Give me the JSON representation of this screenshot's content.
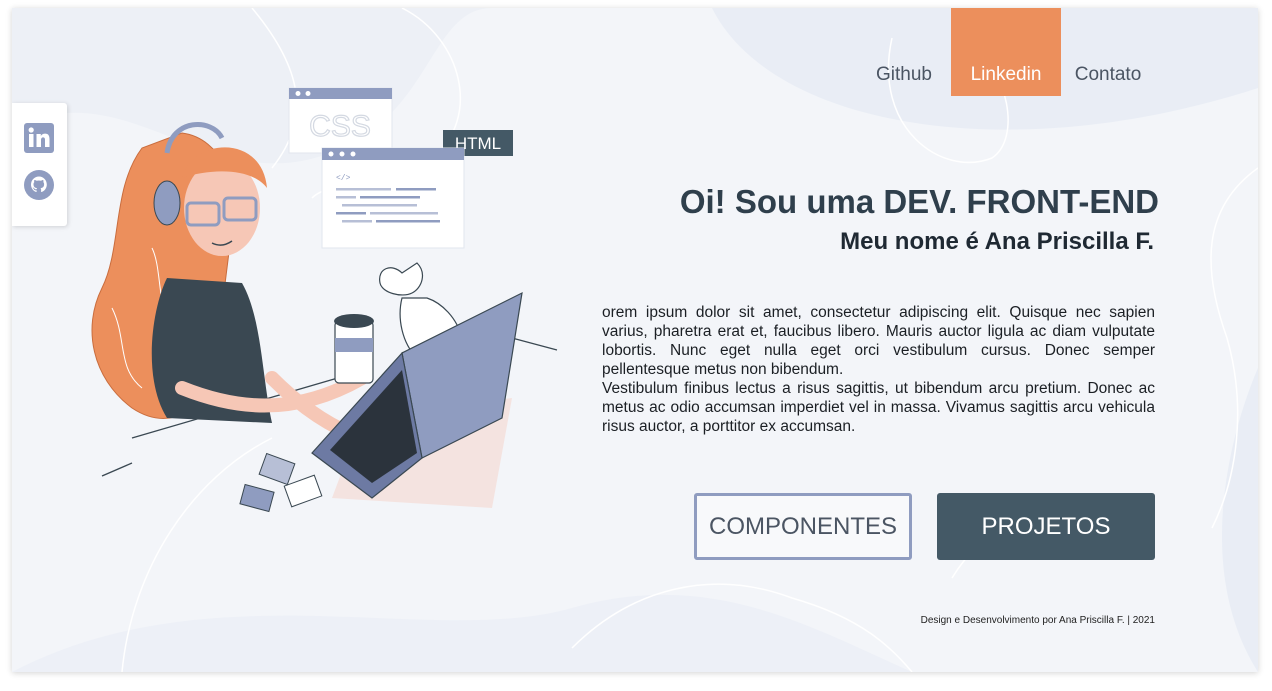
{
  "nav": {
    "items": [
      {
        "label": "Github",
        "active": false
      },
      {
        "label": "Linkedin",
        "active": true
      },
      {
        "label": "Contato",
        "active": false
      }
    ],
    "active_color": "#ec8f5c"
  },
  "social": {
    "icons": [
      "linkedin-icon",
      "github-icon"
    ],
    "icon_color": "#8f9cc0"
  },
  "hero": {
    "title": "Oi! Sou uma DEV. FRONT-END",
    "subtitle": "Meu nome é Ana Priscilla F."
  },
  "intro": {
    "paragraph1": "orem ipsum dolor sit amet, consectetur adipiscing elit. Quisque nec sapien varius, pharetra erat et, faucibus libero. Mauris auctor ligula ac diam vulputate lobortis. Nunc eget nulla eget orci vestibulum cursus. Donec semper pellentesque metus non bibendum.",
    "paragraph2": "Vestibulum finibus lectus a risus sagittis, ut bibendum arcu pretium. Donec ac metus ac odio accumsan imperdiet vel in massa. Vivamus sagittis arcu vehicula risus auctor, a porttitor ex accumsan."
  },
  "buttons": {
    "componentes": "COMPONENTES",
    "projetos": "PROJETOS",
    "primary_color": "#445966"
  },
  "illustration": {
    "css_label": "CSS",
    "html_label": "HTML",
    "code_label": "</>"
  },
  "footer": {
    "credit": "Design e Desenvolvimento por Ana Priscilla F. | 2021"
  }
}
